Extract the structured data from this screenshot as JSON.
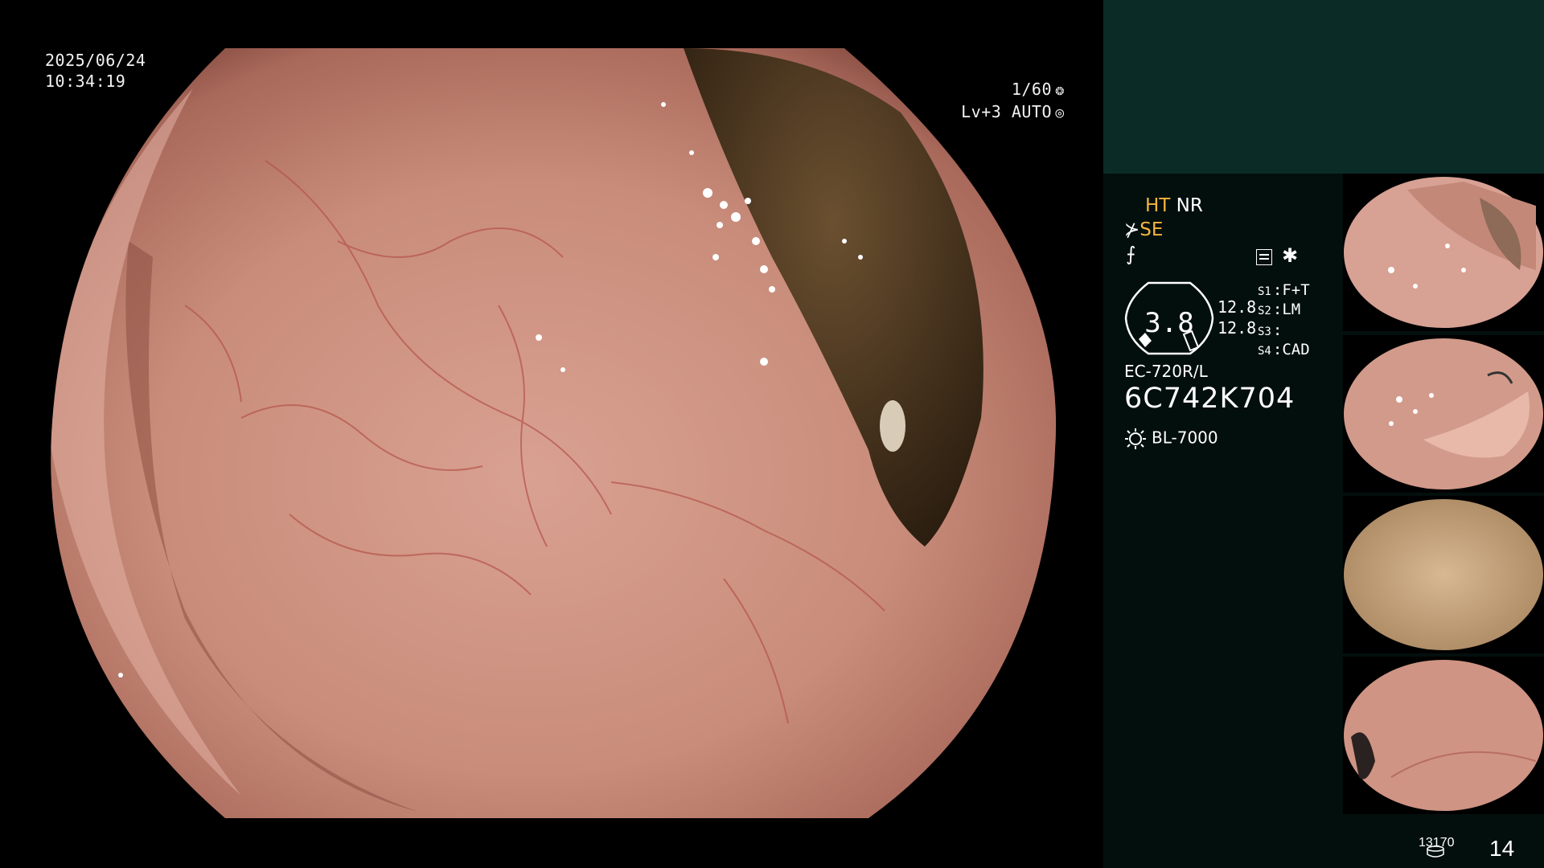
{
  "osd": {
    "date": "2025/06/24",
    "time": "10:34:19",
    "shutter": "1/60",
    "level_mode": "Lv+3 AUTO"
  },
  "panel": {
    "ht": "HT",
    "nr": "NR",
    "se": "SE",
    "dial_value": "3.8",
    "level_a": "12.8",
    "level_b": "12.8",
    "s1_key": "S1",
    "s1_val": "F+T",
    "s2_key": "S2",
    "s2_val": "LM",
    "s3_key": "S3",
    "s3_val": "",
    "s4_key": "S4",
    "s4_val": "CAD",
    "scope_model": "EC-720R/L",
    "scope_serial": "6C742K704",
    "light_source": "BL-7000"
  },
  "footer": {
    "count": "13170",
    "index": "14"
  },
  "colors": {
    "panel_bg": "#030f0d",
    "panel_top": "#0b2b26",
    "accent_yellow": "#f5b53f",
    "mucosa": "#c98c7a"
  },
  "icons": [
    "aperture-icon",
    "auto-iris-icon",
    "structure-enhance-icon",
    "freeze-icon",
    "menu-box-icon",
    "asterisk-icon",
    "dial-gauge-icon",
    "light-bulb-icon",
    "disk-icon"
  ]
}
